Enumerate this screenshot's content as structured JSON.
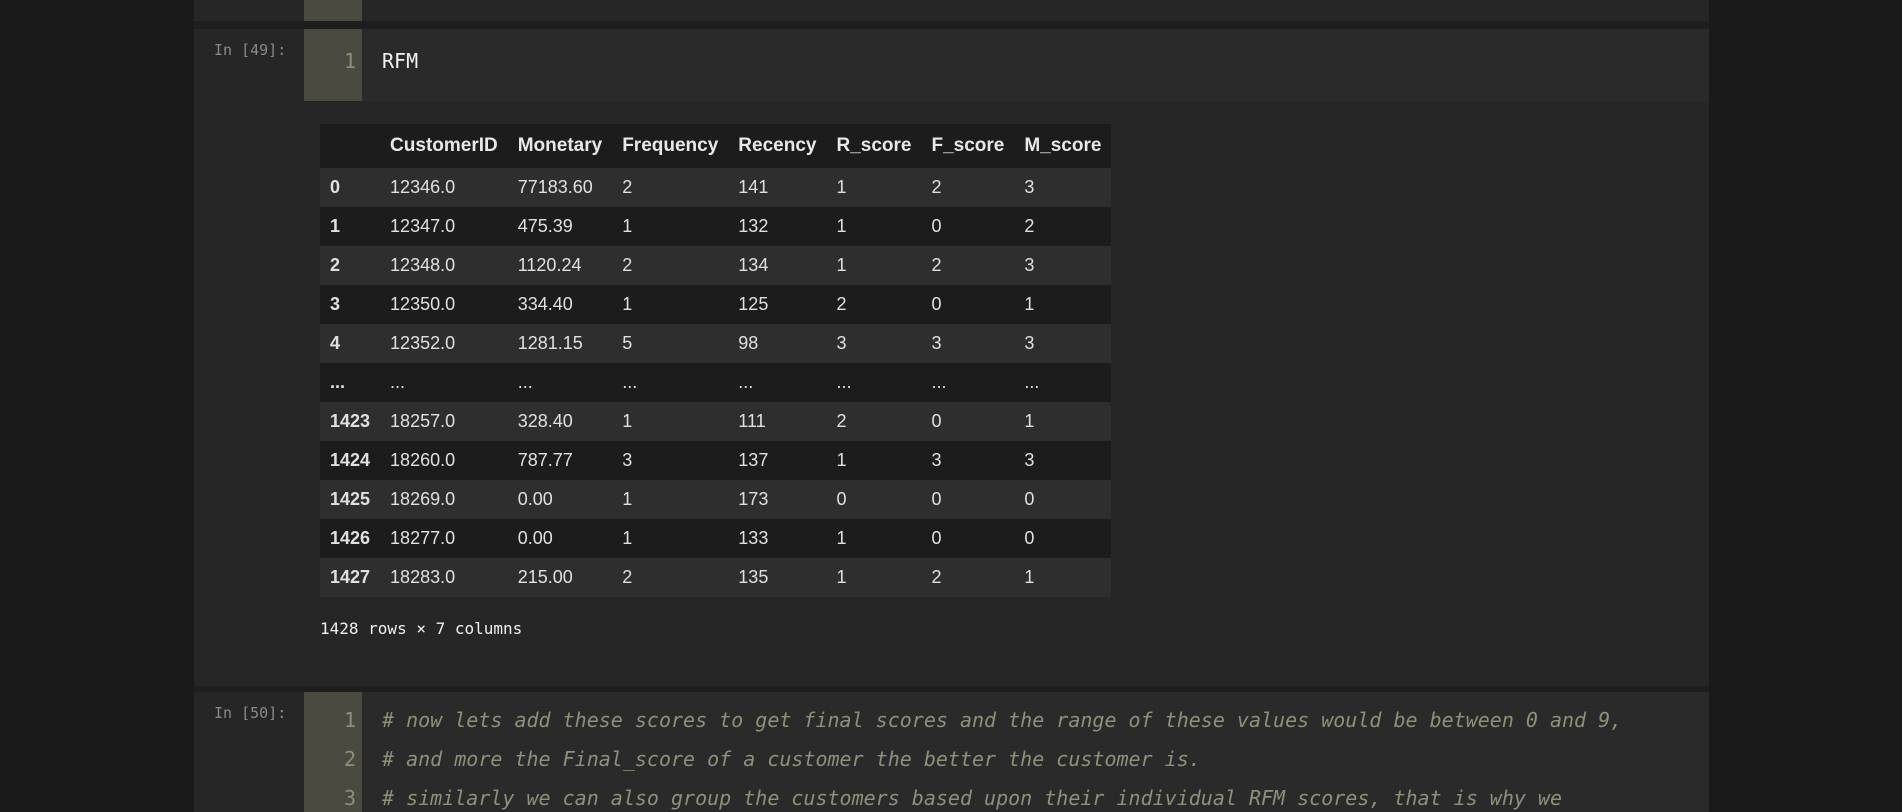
{
  "cells": [
    {
      "prompt": "In [49]:",
      "code": [
        "RFM"
      ],
      "line_numbers": [
        "1"
      ],
      "output": {
        "columns": [
          "",
          "CustomerID",
          "Monetary",
          "Frequency",
          "Recency",
          "R_score",
          "F_score",
          "M_score"
        ],
        "rows": [
          [
            "0",
            "12346.0",
            "77183.60",
            "2",
            "141",
            "1",
            "2",
            "3"
          ],
          [
            "1",
            "12347.0",
            "475.39",
            "1",
            "132",
            "1",
            "0",
            "2"
          ],
          [
            "2",
            "12348.0",
            "1120.24",
            "2",
            "134",
            "1",
            "2",
            "3"
          ],
          [
            "3",
            "12350.0",
            "334.40",
            "1",
            "125",
            "2",
            "0",
            "1"
          ],
          [
            "4",
            "12352.0",
            "1281.15",
            "5",
            "98",
            "3",
            "3",
            "3"
          ],
          [
            "...",
            "...",
            "...",
            "...",
            "...",
            "...",
            "...",
            "..."
          ],
          [
            "1423",
            "18257.0",
            "328.40",
            "1",
            "111",
            "2",
            "0",
            "1"
          ],
          [
            "1424",
            "18260.0",
            "787.77",
            "3",
            "137",
            "1",
            "3",
            "3"
          ],
          [
            "1425",
            "18269.0",
            "0.00",
            "1",
            "173",
            "0",
            "0",
            "0"
          ],
          [
            "1426",
            "18277.0",
            "0.00",
            "1",
            "133",
            "1",
            "0",
            "0"
          ],
          [
            "1427",
            "18283.0",
            "215.00",
            "2",
            "135",
            "1",
            "2",
            "1"
          ]
        ],
        "shape_note": "1428 rows × 7 columns"
      }
    },
    {
      "prompt": "In [50]:",
      "line_numbers": [
        "1",
        "2",
        "3"
      ],
      "code": [
        "# now lets add these scores to get final scores and the range of these values would be between 0 and 9,",
        "# and more the Final_score of a customer the better the customer is.",
        "# similarly we can also group the customers based upon their individual RFM scores, that is why we"
      ]
    }
  ]
}
